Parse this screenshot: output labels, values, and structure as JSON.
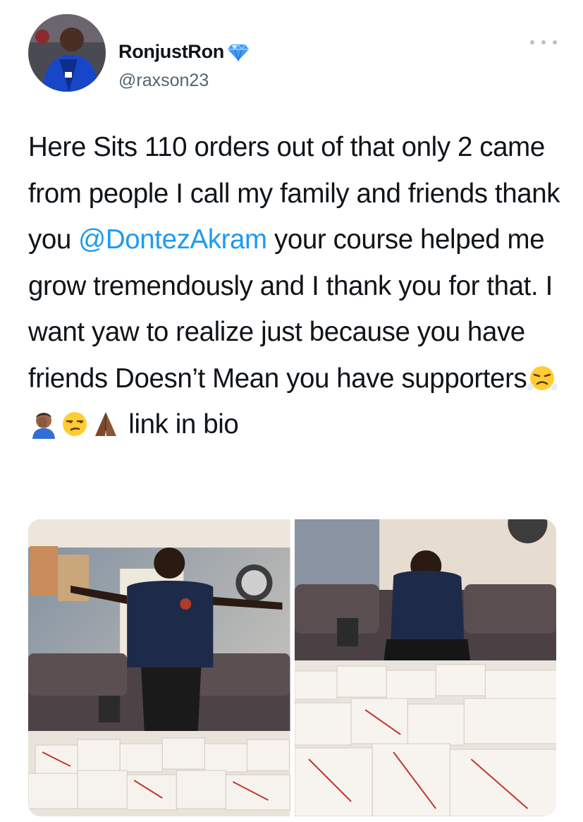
{
  "user": {
    "display_name": "RonjustRon",
    "handle": "@raxson23",
    "verified_icon": "blue-diamond-icon"
  },
  "tweet": {
    "part1": "Here Sits 110 orders out of that only 2 came from people I call my family and friends thank you ",
    "mention": "@DontezAkram",
    "part2": " your course helped me grow tremendously and I thank you for that. I want yaw to realize just because you have friends Doesn’t Mean you have supporters",
    "emojis": [
      "face-with-steam-icon",
      "facepalm-icon",
      "unamused-face-icon",
      "folded-hands-icon"
    ],
    "suffix": " link in bio"
  },
  "media": {
    "images": [
      "photo-man-arms-outstretched",
      "photo-man-praying"
    ]
  },
  "colors": {
    "text": "#0f1419",
    "secondary": "#536471",
    "link": "#1d9bf0"
  }
}
